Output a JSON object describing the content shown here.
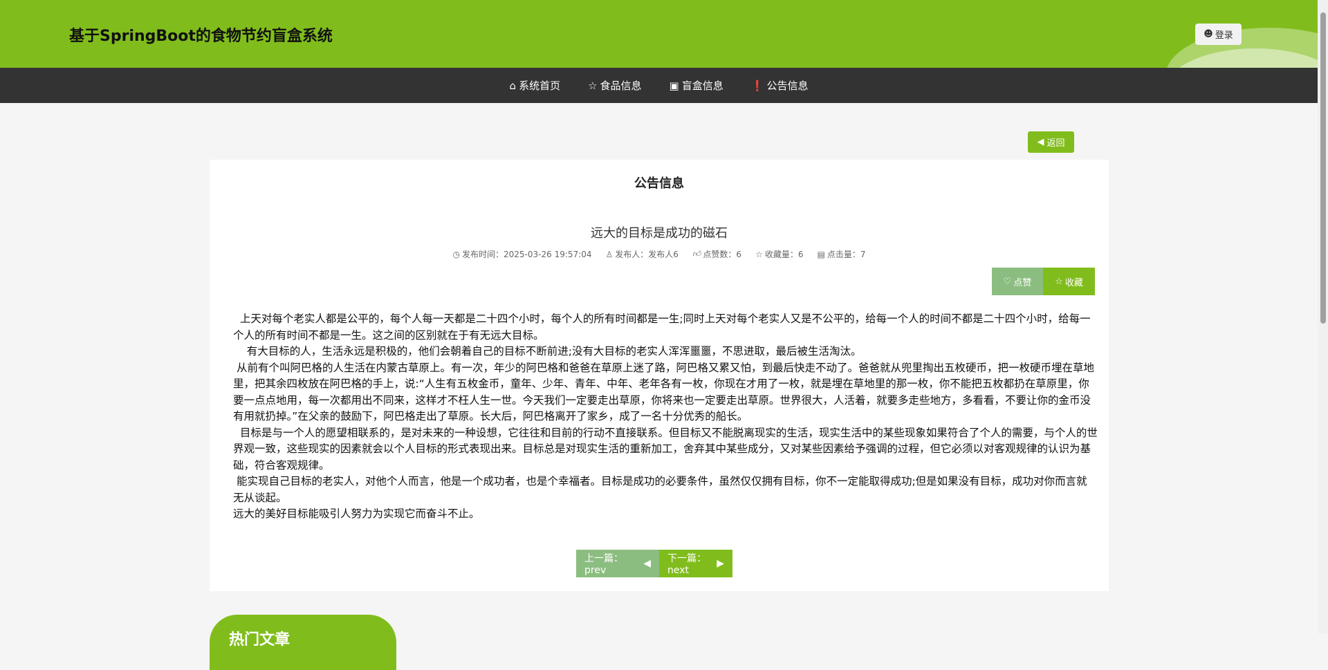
{
  "header": {
    "title": "基于SpringBoot的食物节约盲盒系统",
    "login_label": "登录"
  },
  "nav": {
    "items": [
      {
        "label": "系统首页",
        "icon": "home-icon"
      },
      {
        "label": "食品信息",
        "icon": "star-icon"
      },
      {
        "label": "盲盒信息",
        "icon": "bag-icon"
      },
      {
        "label": "公告信息",
        "icon": "exclamation-icon"
      }
    ]
  },
  "back_label": "返回",
  "section_title": "公告信息",
  "article": {
    "title": "远大的目标是成功的磁石",
    "meta": {
      "time": "发布时间：2025-03-26 19:57:04",
      "publisher": "发布人：发布人6",
      "likes": "点赞数：6",
      "favorites": "收藏量：6",
      "clicks": "点击量：7"
    },
    "like_label": "点赞",
    "favorite_label": "收藏",
    "paragraphs": [
      "  上天对每个老实人都是公平的，每个人每一天都是二十四个小时，每个人的所有时间都是一生;同时上天对每个老实人又是不公平的，给每一个人的时间不都是二十四个小时，给每一个人的所有时间不都是一生。这之间的区别就在于有无远大目标。",
      "    有大目标的人，生活永远是积极的，他们会朝着自己的目标不断前进;没有大目标的老实人浑浑噩噩，不思进取，最后被生活淘汰。",
      " 从前有个叫阿巴格的人生活在内蒙古草原上。有一次，年少的阿巴格和爸爸在草原上迷了路，阿巴格又累又怕，到最后快走不动了。爸爸就从兜里掏出五枚硬币，把一枚硬币埋在草地里，把其余四枚放在阿巴格的手上，说:“人生有五枚金币，童年、少年、青年、中年、老年各有一枚，你现在才用了一枚，就是埋在草地里的那一枚，你不能把五枚都扔在草原里，你要一点点地用，每一次都用出不同来，这样才不枉人生一世。今天我们一定要走出草原，你将来也一定要走出草原。世界很大，人活着，就要多走些地方，多看看，不要让你的金币没有用就扔掉。”在父亲的鼓励下，阿巴格走出了草原。长大后，阿巴格离开了家乡，成了一名十分优秀的船长。",
      "  目标是与一个人的愿望相联系的，是对未来的一种设想，它往往和目前的行动不直接联系。但目标又不能脱离现实的生活，现实生活中的某些现象如果符合了个人的需要，与个人的世界观一致，这些现实的因素就会以个人目标的形式表现出来。目标总是对现实生活的重新加工，舍弃其中某些成分，又对某些因素给予强调的过程，但它必须以对客观规律的认识为基础，符合客观规律。",
      " 能实现自己目标的老实人，对他个人而言，他是一个成功者，也是个幸福者。目标是成功的必要条件，虽然仅仅拥有目标，你不一定能取得成功;但是如果没有目标，成功对你而言就无从谈起。",
      "远大的美好目标能吸引人努力为实现它而奋斗不止。"
    ],
    "prev_label": "上一篇：prev",
    "next_label": "下一篇：next"
  },
  "hot_title": "热门文章",
  "colors": {
    "brand": "#80bd1c",
    "nav": "#333333",
    "muted_green": "#8bbd80"
  }
}
